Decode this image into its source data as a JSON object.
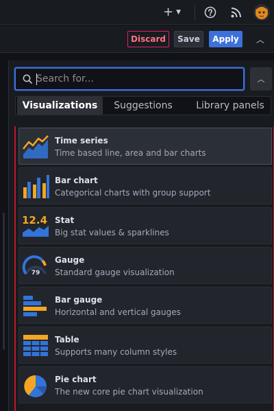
{
  "topbar": {
    "add_icon": "plus-icon",
    "help_icon": "help-circle-icon",
    "news_icon": "rss-icon",
    "avatar_icon": "user-avatar"
  },
  "toolbar": {
    "discard_label": "Discard",
    "save_label": "Save",
    "apply_label": "Apply"
  },
  "search": {
    "placeholder": "Search for...",
    "value": ""
  },
  "tabs": [
    {
      "label": "Visualizations",
      "active": true
    },
    {
      "label": "Suggestions",
      "active": false
    },
    {
      "label": "Library panels",
      "active": false
    }
  ],
  "visualizations": [
    {
      "name": "Time series",
      "description": "Time based line, area and bar charts",
      "selected": true,
      "icon": "time-series-icon"
    },
    {
      "name": "Bar chart",
      "description": "Categorical charts with group support",
      "selected": false,
      "icon": "bar-chart-icon"
    },
    {
      "name": "Stat",
      "description": "Big stat values & sparklines",
      "selected": false,
      "icon": "stat-icon",
      "icon_text": "12.4"
    },
    {
      "name": "Gauge",
      "description": "Standard gauge visualization",
      "selected": false,
      "icon": "gauge-icon",
      "icon_text": "79"
    },
    {
      "name": "Bar gauge",
      "description": "Horizontal and vertical gauges",
      "selected": false,
      "icon": "bar-gauge-icon"
    },
    {
      "name": "Table",
      "description": "Supports many column styles",
      "selected": false,
      "icon": "table-icon"
    },
    {
      "name": "Pie chart",
      "description": "The new core pie chart visualization",
      "selected": false,
      "icon": "pie-chart-icon"
    }
  ],
  "colors": {
    "accent": "#3d71d9",
    "danger": "#e0226e",
    "background": "#111217",
    "card": "#22252b"
  }
}
